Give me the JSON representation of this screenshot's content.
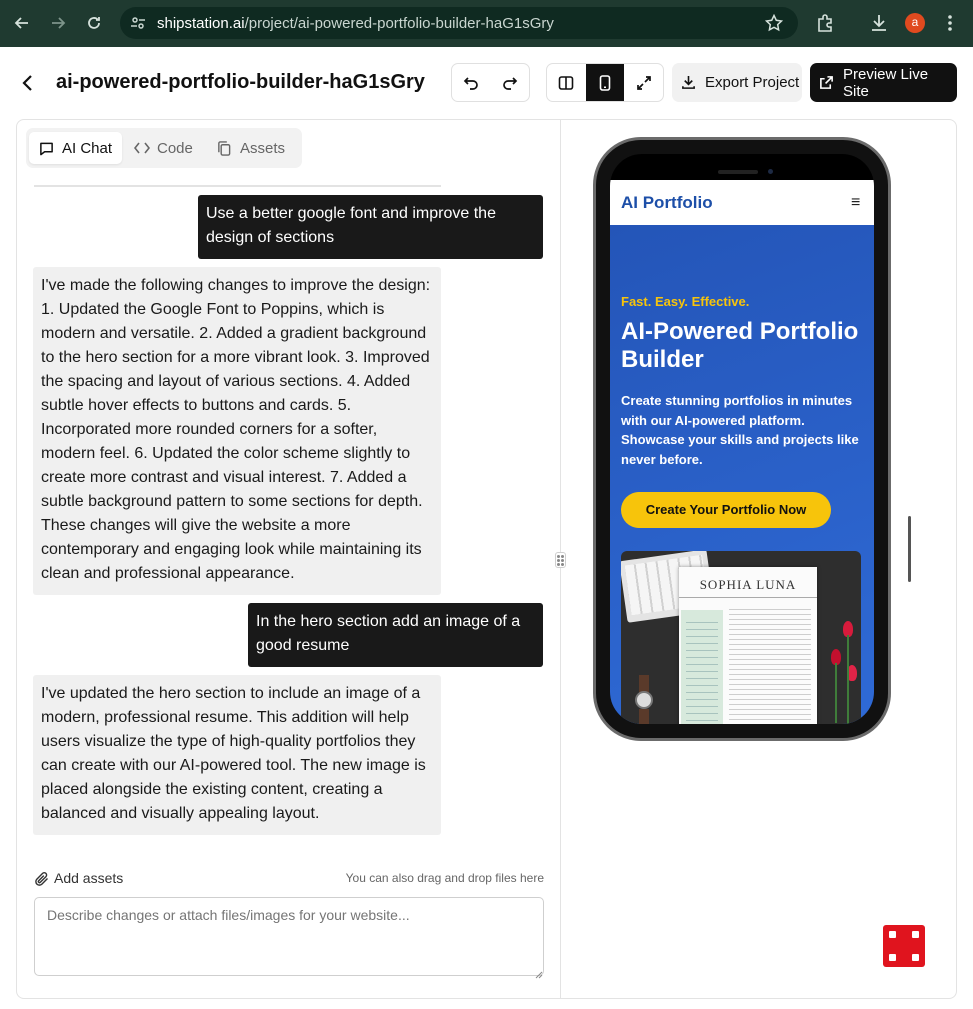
{
  "browser": {
    "url_host": "shipstation.ai",
    "url_path": "/project/ai-powered-portfolio-builder-haG1sGry",
    "profile_initial": "a"
  },
  "header": {
    "project_title": "ai-powered-portfolio-builder-haG1sGry",
    "export_label": "Export Project",
    "preview_label": "Preview Live Site"
  },
  "tabs": [
    {
      "label": "AI Chat",
      "icon": "chat-icon",
      "active": true
    },
    {
      "label": "Code",
      "icon": "code-icon",
      "active": false
    },
    {
      "label": "Assets",
      "icon": "copy-icon",
      "active": false
    }
  ],
  "chat": {
    "messages": [
      {
        "role": "user",
        "text": "Use a better google font and improve the design of sections"
      },
      {
        "role": "assistant",
        "text": "I've made the following changes to improve the design: 1. Updated the Google Font to Poppins, which is modern and versatile. 2. Added a gradient background to the hero section for a more vibrant look. 3. Improved the spacing and layout of various sections. 4. Added subtle hover effects to buttons and cards. 5. Incorporated more rounded corners for a softer, modern feel. 6. Updated the color scheme slightly to create more contrast and visual interest. 7. Added a subtle background pattern to some sections for depth. These changes will give the website a more contemporary and engaging look while maintaining its clean and professional appearance."
      },
      {
        "role": "user",
        "text": "In the hero section add an image of a good resume"
      },
      {
        "role": "assistant",
        "text": "I've updated the hero section to include an image of a modern, professional resume. This addition will help users visualize the type of high-quality portfolios they can create with our AI-powered tool. The new image is placed alongside the existing content, creating a balanced and visually appealing layout."
      }
    ],
    "add_assets_label": "Add assets",
    "drag_hint": "You can also drag and drop files here",
    "input_placeholder": "Describe changes or attach files/images for your website..."
  },
  "preview_site": {
    "logo": "AI Portfolio",
    "menu_icon": "≡",
    "tagline": "Fast. Easy. Effective.",
    "hero_title": "AI-Powered Portfolio Builder",
    "hero_description": "Create stunning portfolios in minutes with our AI-powered platform. Showcase your skills and projects like never before.",
    "cta_label": "Create Your Portfolio Now",
    "resume_name": "SOPHIA LUNA"
  },
  "colors": {
    "browser_bar": "#1f3a30",
    "accent_dark": "#111111",
    "hero_blue": "#2a5fc8",
    "cta_yellow": "#f7c40b",
    "logo_blue": "#1d4fa8",
    "dice_red": "#e0141e"
  }
}
